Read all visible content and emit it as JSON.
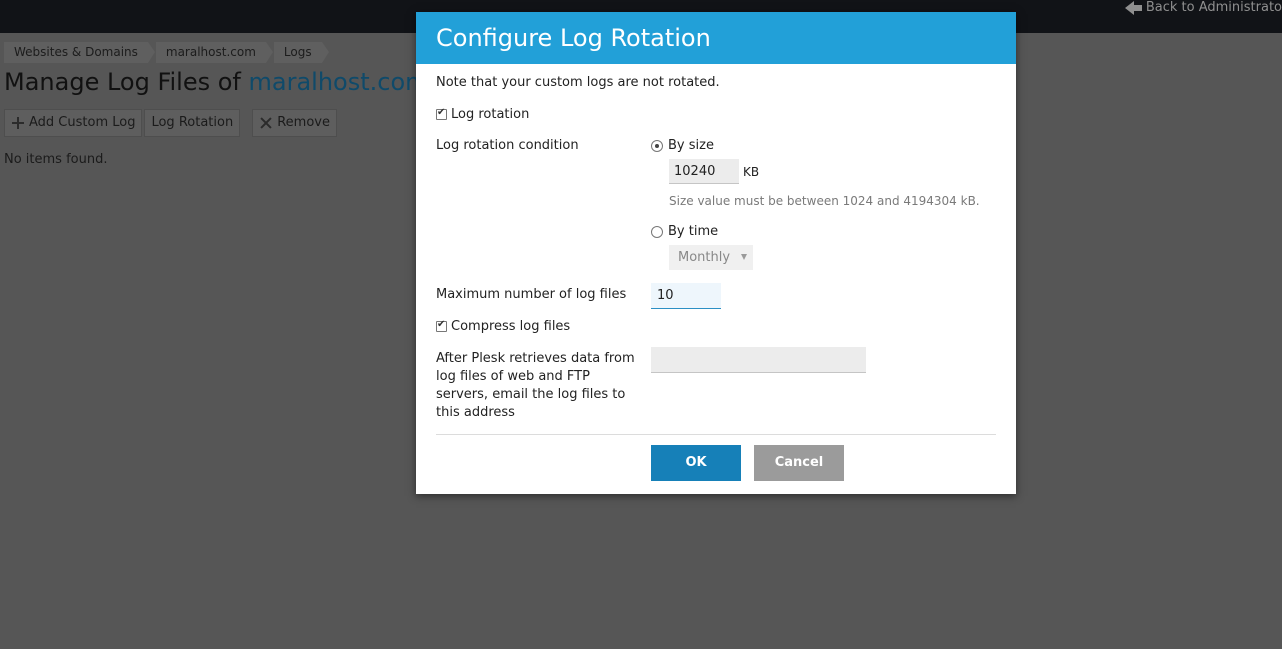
{
  "topbar": {
    "back_label": "Back to Administrato"
  },
  "breadcrumb": [
    "Websites & Domains",
    "maralhost.com",
    "Logs"
  ],
  "page": {
    "title_prefix": "Manage Log Files of ",
    "title_host": "maralhost.com",
    "empty_text": "No items found."
  },
  "toolbar": {
    "add_custom_log": "Add Custom Log",
    "log_rotation": "Log Rotation",
    "remove": "Remove"
  },
  "dialog": {
    "title": "Configure Log Rotation",
    "note": "Note that your custom logs are not rotated.",
    "log_rotation_label": "Log rotation",
    "log_rotation_checked": true,
    "condition_label": "Log rotation condition",
    "by_size_label": "By size",
    "by_size_selected": true,
    "size_value": "10240",
    "size_unit": "KB",
    "size_hint": "Size value must be between 1024 and 4194304 kB.",
    "by_time_label": "By time",
    "by_time_selected": false,
    "time_period": "Monthly",
    "max_files_label": "Maximum number of log files",
    "max_files_value": "10",
    "compress_label": "Compress log files",
    "compress_checked": true,
    "email_label": "After Plesk retrieves data from log files of web and FTP servers, email the log files to this address",
    "email_value": "",
    "ok_label": "OK",
    "cancel_label": "Cancel"
  },
  "colors": {
    "header": "#22a0d8",
    "ok_button": "#1680b8",
    "cancel_button": "#9b9b9b",
    "overlay": "#565656"
  }
}
